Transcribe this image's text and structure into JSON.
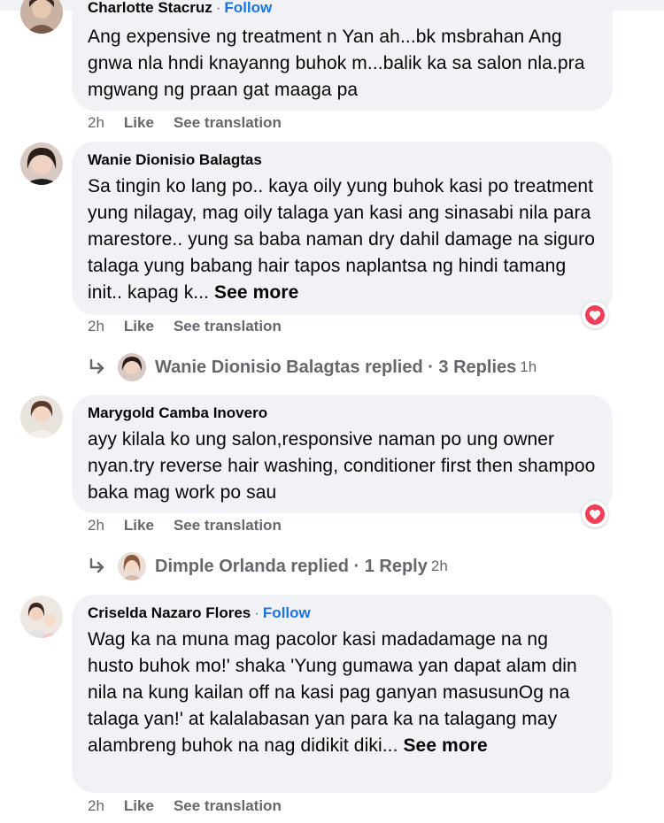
{
  "comments": [
    {
      "author": "Charlotte Stacruz",
      "follow_label": "Follow",
      "separator": "·",
      "text": "Ang expensive ng treatment n Yan ah...bk msbrahan Ang gnwa nla hndi knayanng buhok m...balik ka sa salon nla.pra mgwang ng praan gat maaga pa",
      "time": "2h",
      "like_label": "Like",
      "translate_label": "See translation"
    },
    {
      "author": "Wanie Dionisio Balagtas",
      "text": "Sa tingin ko lang po.. kaya oily yung buhok kasi po treatment yung nilagay, mag oily talaga yan kasi ang sinasabi nila para marestore.. yung sa baba naman dry dahil damage na siguro talaga yung babang hair tapos naplantsa ng hindi tamang init.. kapag k...",
      "see_more": "See more",
      "time": "2h",
      "like_label": "Like",
      "translate_label": "See translation",
      "reaction": "heart-reaction",
      "replies": {
        "text": "Wanie Dionisio Balagtas replied · 3 Replies",
        "time": "1h"
      }
    },
    {
      "author": "Marygold Camba Inovero",
      "text": "ayy kilala ko ung salon,responsive naman po ung owner nyan.try reverse hair washing, conditioner first then shampoo baka mag work po sau",
      "time": "2h",
      "like_label": "Like",
      "translate_label": "See translation",
      "reaction": "heart-reaction",
      "replies": {
        "text": "Dimple Orlanda replied · 1 Reply",
        "time": "2h"
      }
    },
    {
      "author": "Criselda Nazaro Flores",
      "follow_label": "Follow",
      "separator": "·",
      "text": "Wag ka na muna mag pacolor kasi madadamage na ng husto buhok mo!' shaka 'Yung gumawa yan dapat alam din nila na kung kailan off na kasi pag ganyan masusunOg na talaga yan!' at kalalabasan yan para ka na talagang may alambreng buhok na nag didikit diki...",
      "see_more": "See more",
      "time": "2h",
      "like_label": "Like",
      "translate_label": "See translation"
    }
  ],
  "colors": {
    "bubble": "#f0f2f5",
    "follow": "#1b74e4",
    "meta": "#65676b",
    "heart": "#f33e58"
  }
}
